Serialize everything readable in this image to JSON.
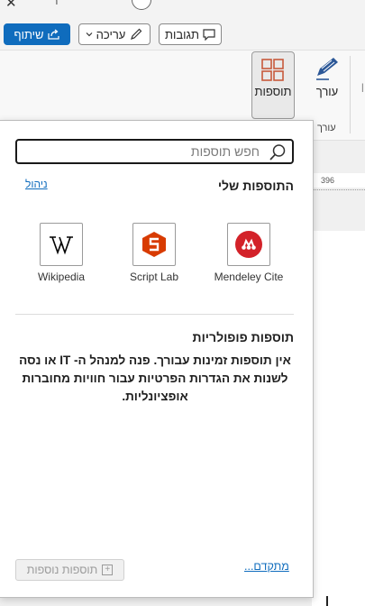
{
  "titlebar": {
    "close_glyph": "✕",
    "partial_glyph": "ר"
  },
  "toolbar": {
    "share_label": "שיתוף",
    "edit_label": "עריכה",
    "comments_label": "תגובות"
  },
  "ribbon": {
    "addins_label": "תוספות",
    "editor_label": "עורך",
    "group_label": "עורך"
  },
  "ruler": {
    "value": "396"
  },
  "pane": {
    "search_placeholder": "חפש תוספות",
    "my_addins_title": "התוספות שלי",
    "manage_link": "ניהול",
    "addins": [
      {
        "name": "Mendeley Cite",
        "icon": "mendeley-icon",
        "color": "#d32229"
      },
      {
        "name": "Script Lab",
        "icon": "script-lab-icon",
        "color": "#d83b01"
      },
      {
        "name": "Wikipedia",
        "icon": "wikipedia-icon",
        "color": "#000000"
      }
    ],
    "popular_title": "תוספות פופולריות",
    "popular_message": "אין תוספות זמינות עבורך. פנה למנהל ה- IT או נסה לשנות את הגדרות הפרטיות עבור חוויות מחוברות אופציונליות.",
    "advanced_link": "מתקדם...",
    "more_addins_button": "תוספות נוספות"
  },
  "colors": {
    "accent": "#0f6cbd",
    "addins_icon": "#c85a3c",
    "editor_icon": "#2b5797"
  }
}
